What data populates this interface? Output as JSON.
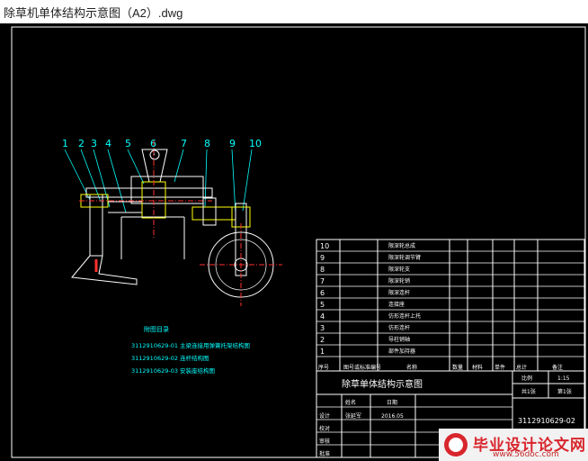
{
  "window": {
    "title": "除草机单体结构示意图（A2）.dwg"
  },
  "colors": {
    "background": "#000000",
    "frame": "#ffffff",
    "callout": "#00ffff",
    "red": "#ff3030",
    "yellow": "#ffff00",
    "green": "#00ff66"
  },
  "callouts": [
    "1",
    "2",
    "3",
    "4",
    "5",
    "6",
    "7",
    "8",
    "9",
    "10"
  ],
  "attached_drawings": {
    "heading": "附图目录",
    "items": [
      "3112910629-01 主梁连接用弹簧托架结构图",
      "3112910629-02 连杆结构图",
      "3112910629-03 安装座结构图"
    ]
  },
  "parts_list": {
    "rows": [
      {
        "no": "10",
        "name": "限深轮总成"
      },
      {
        "no": "9",
        "name": "限深轮调节臂"
      },
      {
        "no": "8",
        "name": "限深轮支"
      },
      {
        "no": "7",
        "name": "限深轮销"
      },
      {
        "no": "6",
        "name": "限深连杆"
      },
      {
        "no": "5",
        "name": "连接座"
      },
      {
        "no": "4",
        "name": "仿形连杆上托"
      },
      {
        "no": "3",
        "name": "仿形连杆"
      },
      {
        "no": "2",
        "name": "导柱销轴"
      },
      {
        "no": "1",
        "name": "部件加持器"
      }
    ],
    "header": {
      "col_no": "序号",
      "col_code": "图号或标准编号",
      "col_name": "名称",
      "col_qty": "数量",
      "col_material": "材料",
      "col_weight": "单件",
      "col_total": "总计",
      "col_remark": "备注"
    }
  },
  "title_block": {
    "drawing_title": "除草单体结构示意图",
    "drawing_no": "3112910629-02",
    "scale_label": "比例",
    "scale": "1:15",
    "sheet_label": "共1张",
    "sheet": "第1张",
    "designer_label": "设计",
    "designer": "张延军",
    "date": "2016.05",
    "header_name": "姓名",
    "header_date": "日期",
    "check_label": "校对",
    "review_label": "审核",
    "approve_label": "批准"
  },
  "watermark": {
    "text": "毕业设计论文网",
    "url": "www.56doc.com"
  }
}
